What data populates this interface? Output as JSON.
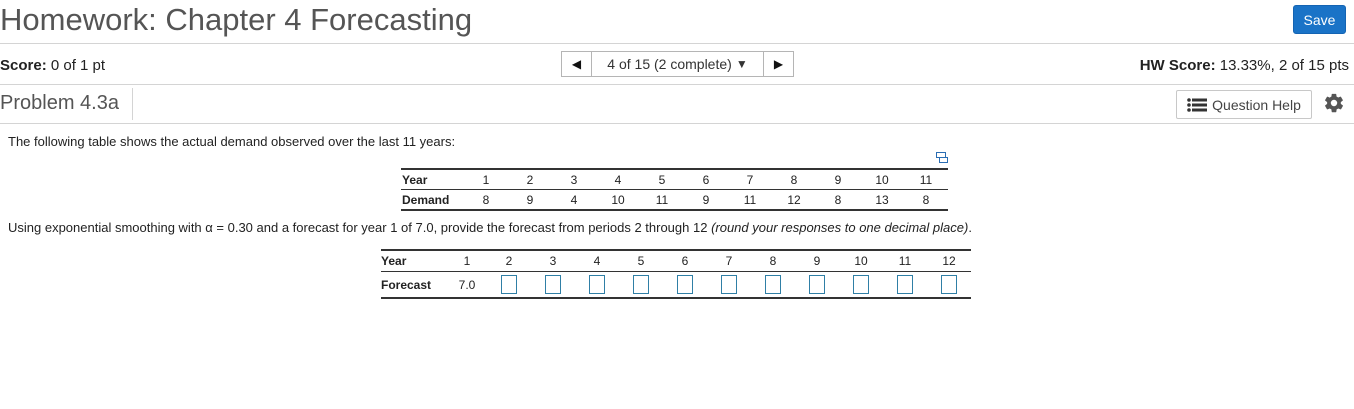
{
  "header": {
    "title": "Homework: Chapter 4 Forecasting",
    "save_label": "Save"
  },
  "score": {
    "label": "Score:",
    "value": "0 of 1 pt"
  },
  "nav": {
    "current": "4 of 15 (2 complete)"
  },
  "hw_score": {
    "label": "HW Score:",
    "value": "13.33%, 2 of 15 pts"
  },
  "problem": {
    "title": "Problem 4.3a",
    "help_label": "Question Help"
  },
  "question": {
    "intro": "The following table shows the actual demand observed over the last 11 years:",
    "instruction_main": "Using exponential smoothing with α = 0.30 and a forecast for year 1 of 7.0, provide the forecast from periods 2 through 12 ",
    "instruction_italic": "(round your responses to one decimal place)",
    "instruction_end": "."
  },
  "demand_table": {
    "row_labels": [
      "Year",
      "Demand"
    ],
    "years": [
      "1",
      "2",
      "3",
      "4",
      "5",
      "6",
      "7",
      "8",
      "9",
      "10",
      "11"
    ],
    "demand": [
      "8",
      "9",
      "4",
      "10",
      "11",
      "9",
      "11",
      "12",
      "8",
      "13",
      "8"
    ]
  },
  "forecast_table": {
    "row_labels": [
      "Year",
      "Forecast"
    ],
    "years": [
      "1",
      "2",
      "3",
      "4",
      "5",
      "6",
      "7",
      "8",
      "9",
      "10",
      "11",
      "12"
    ],
    "first_forecast": "7.0",
    "inputs": [
      "",
      "",
      "",
      "",
      "",
      "",
      "",
      "",
      "",
      "",
      ""
    ]
  },
  "colors": {
    "accent": "#1a73c7",
    "input_border": "#2f7fa6"
  }
}
